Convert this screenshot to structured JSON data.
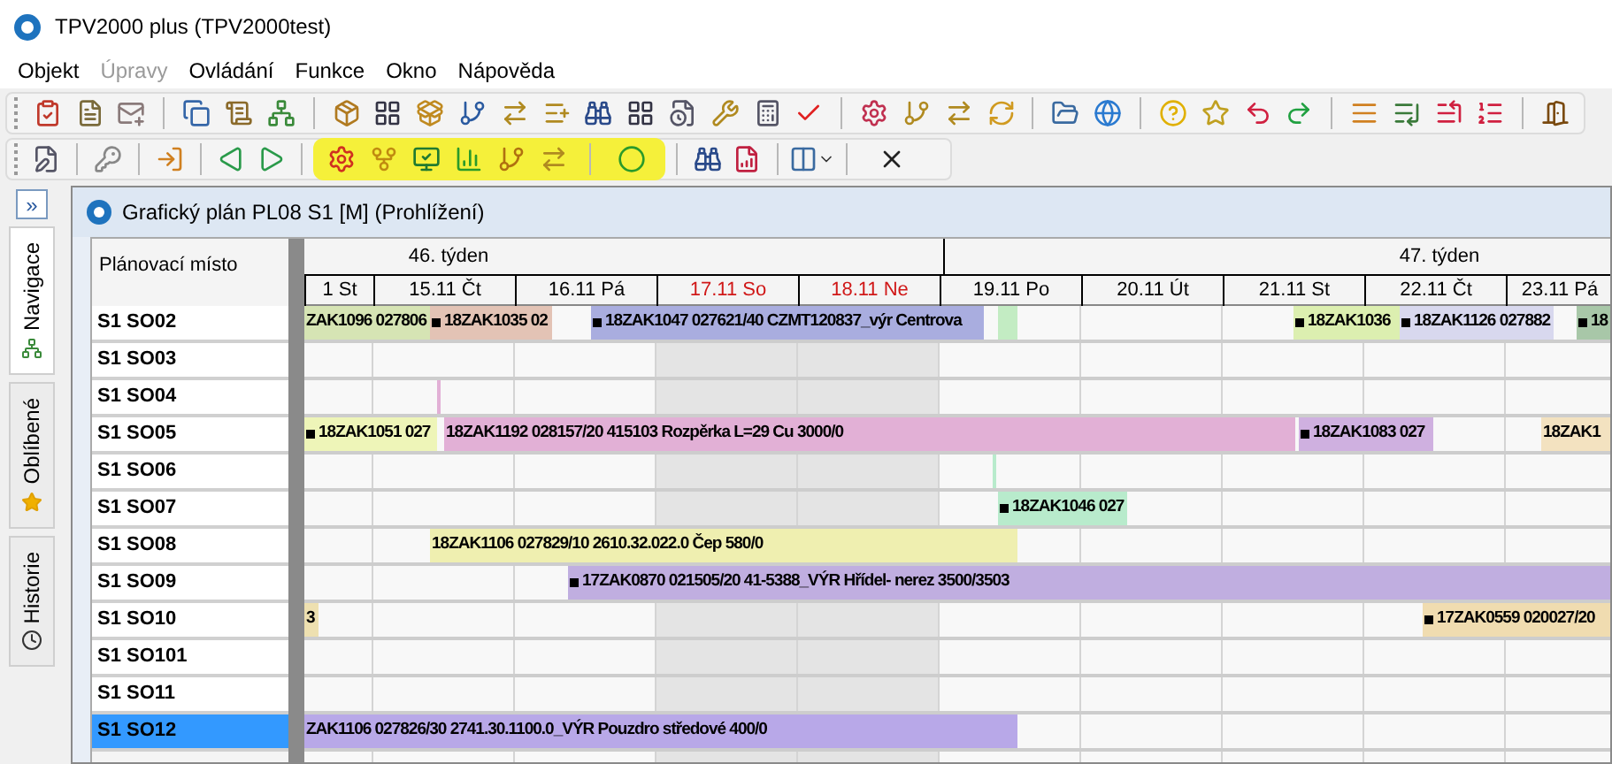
{
  "window": {
    "title": "TPV2000 plus (TPV2000test)"
  },
  "menu": [
    {
      "label": "Objekt",
      "disabled": false
    },
    {
      "label": "Úpravy",
      "disabled": true
    },
    {
      "label": "Ovládání",
      "disabled": false
    },
    {
      "label": "Funkce",
      "disabled": false
    },
    {
      "label": "Okno",
      "disabled": false
    },
    {
      "label": "Nápověda",
      "disabled": false
    }
  ],
  "side_toggle": "»",
  "side_tabs": [
    {
      "label": "Navigace",
      "selected": true
    },
    {
      "label": "Oblíbené",
      "selected": false
    },
    {
      "label": "Historie",
      "selected": false
    }
  ],
  "plan_window": {
    "title": "Grafický plán PL08 S1 [M] (Prohlížení)",
    "column_header": "Plánovací místo",
    "weeks": [
      {
        "label": "46. týden"
      },
      {
        "label": "47. týden"
      }
    ],
    "days": [
      {
        "label": "1 St",
        "weekend": false
      },
      {
        "label": "15.11 Čt",
        "weekend": false
      },
      {
        "label": "16.11 Pá",
        "weekend": false
      },
      {
        "label": "17.11 So",
        "weekend": true
      },
      {
        "label": "18.11 Ne",
        "weekend": true
      },
      {
        "label": "19.11 Po",
        "weekend": false
      },
      {
        "label": "20.11 Út",
        "weekend": false
      },
      {
        "label": "21.11 St",
        "weekend": false
      },
      {
        "label": "22.11 Čt",
        "weekend": false
      },
      {
        "label": "23.11 Pá",
        "weekend": false
      }
    ],
    "rows": [
      {
        "label": "S1 SO02",
        "selected": false,
        "bars": [
          {
            "label": "ZAK1096 027806",
            "color": "#d6e4b4",
            "marker": false
          },
          {
            "label": "18ZAK1035 02",
            "color": "#e3c3b5",
            "marker": true
          },
          {
            "label": "18ZAK1047 027621/40 CZMT120837_výr Centrova",
            "color": "#a9addf",
            "marker": true
          },
          {
            "color": "#c3ecc3",
            "marker": false
          },
          {
            "label": "18ZAK1036",
            "color": "#dcefb0",
            "marker": true
          },
          {
            "label": "18ZAK1126 027882",
            "color": "#d8d8ee",
            "marker": true
          },
          {
            "label": "18",
            "color": "#a8c7a8",
            "marker": true
          }
        ]
      },
      {
        "label": "S1 SO03",
        "selected": false,
        "bars": []
      },
      {
        "label": "S1 SO04",
        "selected": false,
        "bars": [
          {
            "color": "#e2b0d6",
            "marker": false
          }
        ]
      },
      {
        "label": "S1 SO05",
        "selected": false,
        "bars": [
          {
            "label": "18ZAK1051 027",
            "color": "#eef5b8",
            "marker": true
          },
          {
            "label": "18ZAK1192 028157/20 415103 Rozpěrka L=29 Cu 3000/0",
            "color": "#e2b0d6",
            "marker": false
          },
          {
            "label": "18ZAK1083 027",
            "color": "#cfb0e0",
            "marker": true
          },
          {
            "label": "18ZAK1",
            "color": "#f3e2c0",
            "marker": false
          }
        ]
      },
      {
        "label": "S1 SO06",
        "selected": false,
        "bars": [
          {
            "color": "#b8ebcc",
            "marker": false
          }
        ]
      },
      {
        "label": "S1 SO07",
        "selected": false,
        "bars": [
          {
            "label": "18ZAK1046 027",
            "color": "#b8ebcc",
            "marker": true
          }
        ]
      },
      {
        "label": "S1 SO08",
        "selected": false,
        "bars": [
          {
            "label": "18ZAK1106 027829/10 2610.32.022.0 Čep 580/0",
            "color": "#efefb0",
            "marker": false
          }
        ]
      },
      {
        "label": "S1 SO09",
        "selected": false,
        "bars": [
          {
            "label": "17ZAK0870 021505/20 41-5388_VÝR Hřídel- nerez 3500/3503",
            "color": "#c0aee0",
            "marker": true
          }
        ]
      },
      {
        "label": "S1 SO10",
        "selected": false,
        "bars": [
          {
            "label": "3",
            "color": "#eee0b0",
            "marker": false
          },
          {
            "label": "17ZAK0559 020027/20",
            "color": "#f0dcb0",
            "marker": true
          }
        ]
      },
      {
        "label": "S1 SO101",
        "selected": false,
        "bars": []
      },
      {
        "label": "S1 SO11",
        "selected": false,
        "bars": []
      },
      {
        "label": "S1 SO12",
        "selected": true,
        "bars": [
          {
            "label": "ZAK1106 027826/30 2741.30.1100.0_VÝR Pouzdro středové 400/0",
            "color": "#b8a8e8",
            "marker": false
          }
        ]
      }
    ]
  }
}
